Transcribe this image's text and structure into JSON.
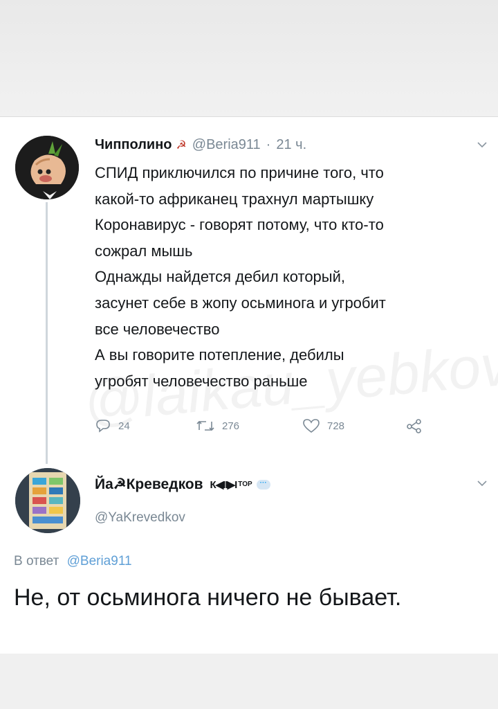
{
  "tweet": {
    "display_name": "Чипполино",
    "name_emoji": "☭",
    "handle": "@Beria911",
    "separator": "·",
    "time": "21 ч.",
    "lines": [
      "СПИД приключился  по причине того, что",
      "какой-то африканец трахнул мартышку",
      "Коронавирус - говорят потому, что кто-то",
      "сожрал мышь",
      "Однажды найдется дебил который,",
      "засунет себе в жопу осьминога и угробит",
      "все человечество",
      "А вы говорите потепление, дебилы",
      "угробят человечество раньше"
    ],
    "reply_count": "24",
    "retweet_count": "276",
    "like_count": "728"
  },
  "reply": {
    "display_name": "Йа☭Креведков",
    "name_suffix": "К◀II▶I",
    "top_badge": "TOP",
    "bubble": "···",
    "handle": "@YaKrevedkov",
    "in_reply_label": "В ответ",
    "in_reply_mention": "@Beria911",
    "text": "Не, от осьминога ничего не бывает."
  },
  "watermark": "@laikau_yebkov",
  "icons": {
    "avatar_1": "onion-avatar",
    "avatar_2": "phone-screenshot-avatar",
    "reply": "reply-icon",
    "retweet": "retweet-icon",
    "like": "heart-icon",
    "share": "share-icon",
    "more": "chevron-down-icon"
  },
  "colors": {
    "text": "#14171a",
    "muted": "#7a8894",
    "link": "#5f9fd6",
    "thread": "#cfd6dc"
  }
}
